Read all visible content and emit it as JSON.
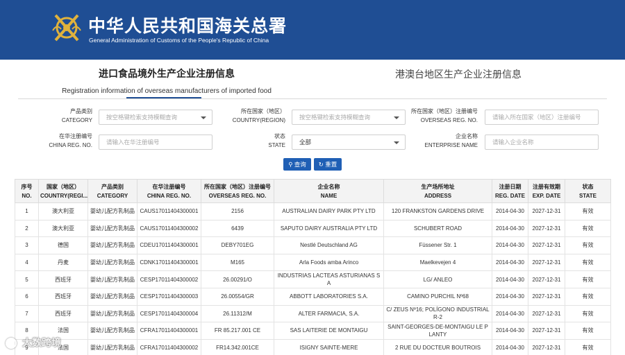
{
  "header": {
    "title_cn": "中华人民共和国海关总署",
    "title_en": "General Administration of Customs of the People's Republic of China",
    "logo_icon": "customs-emblem-icon"
  },
  "tabs": {
    "active_cn": "进口食品境外生产企业注册信息",
    "active_en": "Registration information of overseas manufacturers of imported food",
    "other_cn": "港澳台地区生产企业注册信息"
  },
  "filters": {
    "category": {
      "label_cn": "产品类别",
      "label_en": "CATEGORY",
      "placeholder": "按空格键检索支持模糊查询"
    },
    "country": {
      "label_cn": "所在国家（地区）",
      "label_en": "COUNTRY(REGION)",
      "placeholder": "按空格键检索支持模糊查询"
    },
    "overseas_reg": {
      "label_cn": "所在国家（地区）注册编号",
      "label_en": "OVERSEAS REG. NO.",
      "placeholder": "请输入所在国家（地区）注册编号"
    },
    "china_reg": {
      "label_cn": "在华注册编号",
      "label_en": "CHINA REG. NO.",
      "placeholder": "请输入在华注册编号"
    },
    "state": {
      "label_cn": "状态",
      "label_en": "STATE",
      "value": "全部"
    },
    "enterprise": {
      "label_cn": "企业名称",
      "label_en": "ENTERPRISE NAME",
      "placeholder": "请输入企业名称"
    }
  },
  "buttons": {
    "search": "查询",
    "reset": "重置",
    "search_icon": "search-icon",
    "reset_icon": "refresh-icon"
  },
  "table": {
    "headers": [
      {
        "cn": "序号",
        "en": "NO."
      },
      {
        "cn": "国家（地区）",
        "en": "COUNTRY(REGI..."
      },
      {
        "cn": "产品类别",
        "en": "CATEGORY"
      },
      {
        "cn": "在华注册编号",
        "en": "CHINA REG. NO."
      },
      {
        "cn": "所在国家（地区）注册编号",
        "en": "OVERSEAS REG. NO."
      },
      {
        "cn": "企业名称",
        "en": "NAME"
      },
      {
        "cn": "生产场所地址",
        "en": "ADDRESS"
      },
      {
        "cn": "注册日期",
        "en": "REG. DATE"
      },
      {
        "cn": "注册有效期",
        "en": "EXP. DATE"
      },
      {
        "cn": "状态",
        "en": "STATE"
      }
    ],
    "rows": [
      [
        "1",
        "澳大利亚",
        "婴幼儿配方乳制品",
        "CAUS17011404300001",
        "2156",
        "AUSTRALIAN DAIRY PARK PTY LTD",
        "120 FRANKSTON GARDENS DRIVE",
        "2014-04-30",
        "2027-12-31",
        "有效"
      ],
      [
        "2",
        "澳大利亚",
        "婴幼儿配方乳制品",
        "CAUS17011404300002",
        "6439",
        "SAPUTO DAIRY AUSTRALIA PTY LTD",
        "SCHUBERT ROAD",
        "2014-04-30",
        "2027-12-31",
        "有效"
      ],
      [
        "3",
        "德国",
        "婴幼儿配方乳制品",
        "CDEU17011404300001",
        "DEBY701EG",
        "Nestlé Deutschland AG",
        "Füssener Str. 1",
        "2014-04-30",
        "2027-12-31",
        "有效"
      ],
      [
        "4",
        "丹麦",
        "婴幼儿配方乳制品",
        "CDNK17011404300001",
        "M165",
        "Arla Foods amba Arinco",
        "Maelkevejen 4",
        "2014-04-30",
        "2027-12-31",
        "有效"
      ],
      [
        "5",
        "西班牙",
        "婴幼儿配方乳制品",
        "CESP17011404300002",
        "26.00291/O",
        "INDUSTRIAS LACTEAS ASTURIANAS SA",
        "LG/ ANLEO",
        "2014-04-30",
        "2027-12-31",
        "有效"
      ],
      [
        "6",
        "西班牙",
        "婴幼儿配方乳制品",
        "CESP17011404300003",
        "26.00554/GR",
        "ABBOTT LABORATORIES S.A.",
        "CAMINO PURCHIL Nº68",
        "2014-04-30",
        "2027-12-31",
        "有效"
      ],
      [
        "7",
        "西班牙",
        "婴幼儿配方乳制品",
        "CESP17011404300004",
        "26.11312/M",
        "ALTER FARMACIA, S.A.",
        "C/ ZEUS Nº16; POLÍGONO INDUSTRIAL R-2",
        "2014-04-30",
        "2027-12-31",
        "有效"
      ],
      [
        "8",
        "法国",
        "婴幼儿配方乳制品",
        "CFRA17011404300001",
        "FR 85.217.001 CE",
        "SAS LAITERIE DE MONTAIGU",
        "SAINT-GEORGES-DE-MONTAIGU LE PLANTY",
        "2014-04-30",
        "2027-12-31",
        "有效"
      ],
      [
        "9",
        "法国",
        "婴幼儿配方乳制品",
        "CFRA17011404300002",
        "FR14.342.001CE",
        "ISIGNY SAINTE-MERE",
        "2 RUE DU DOCTEUR BOUTROIS",
        "2014-04-30",
        "2027-12-31",
        "有效"
      ]
    ]
  },
  "watermark": "大数跨境"
}
